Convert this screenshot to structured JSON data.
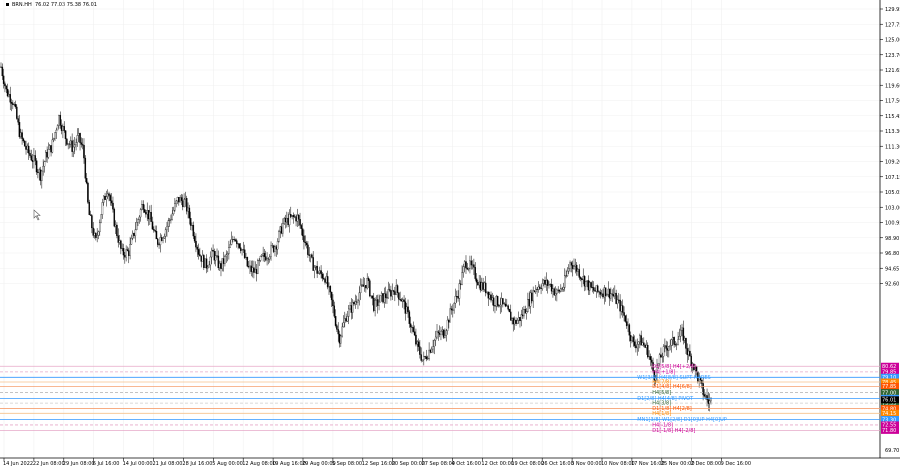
{
  "symbol_header": {
    "symbol": "BRN.HH",
    "ohlc": "76.02 77.03 75.38 76.01"
  },
  "chart_data": {
    "type": "candlestick",
    "symbol": "BRN.HH",
    "price_axis": {
      "min": 68.0,
      "max": 131.0,
      "tick_labels": [
        "129.95",
        "127.75",
        "125.00",
        "123.70",
        "121.65",
        "119.60",
        "117.50",
        "115.45",
        "113.30",
        "111.30",
        "109.20",
        "107.15",
        "105.05",
        "103.00",
        "100.95",
        "98.90",
        "96.80",
        "94.65",
        "92.60"
      ]
    },
    "time_axis": {
      "tick_labels": [
        "14 Jun 2022",
        "22 Jun 08:00",
        "29 Jun 08:00",
        "6 Jul 16:00",
        "14 Jul 00:00",
        "21 Jul 08:00",
        "28 Jul 16:00",
        "5 Aug 00:00",
        "12 Aug 08:00",
        "19 Aug 16:00",
        "29 Aug 00:00",
        "5 Sep 08:00",
        "12 Sep 16:00",
        "20 Sep 00:00",
        "27 Sep 08:00",
        "4 Oct 16:00",
        "12 Oct 00:00",
        "19 Oct 08:00",
        "26 Oct 16:00",
        "3 Nov 00:00",
        "10 Nov 08:00",
        "17 Nov 16:00",
        "25 Nov 00:00",
        "2 Dec 08:00",
        "9 Dec 16:00"
      ]
    },
    "price_path": [
      {
        "x": 0,
        "y": 121.8
      },
      {
        "x": 0.006,
        "y": 118.5
      },
      {
        "x": 0.014,
        "y": 117.0
      },
      {
        "x": 0.022,
        "y": 112.3
      },
      {
        "x": 0.03,
        "y": 110.2
      },
      {
        "x": 0.038,
        "y": 108.8
      },
      {
        "x": 0.045,
        "y": 106.9
      },
      {
        "x": 0.052,
        "y": 109.8
      },
      {
        "x": 0.058,
        "y": 110.9
      },
      {
        "x": 0.066,
        "y": 115.0
      },
      {
        "x": 0.074,
        "y": 112.0
      },
      {
        "x": 0.082,
        "y": 110.6
      },
      {
        "x": 0.088,
        "y": 112.1
      },
      {
        "x": 0.094,
        "y": 110.4
      },
      {
        "x": 0.1,
        "y": 101.8
      },
      {
        "x": 0.108,
        "y": 97.6
      },
      {
        "x": 0.116,
        "y": 102.9
      },
      {
        "x": 0.122,
        "y": 105.2
      },
      {
        "x": 0.13,
        "y": 100.1
      },
      {
        "x": 0.138,
        "y": 96.1
      },
      {
        "x": 0.146,
        "y": 96.4
      },
      {
        "x": 0.154,
        "y": 99.9
      },
      {
        "x": 0.162,
        "y": 103.1
      },
      {
        "x": 0.17,
        "y": 101.0
      },
      {
        "x": 0.178,
        "y": 97.6
      },
      {
        "x": 0.186,
        "y": 99.0
      },
      {
        "x": 0.194,
        "y": 101.2
      },
      {
        "x": 0.202,
        "y": 103.6
      },
      {
        "x": 0.21,
        "y": 103.2
      },
      {
        "x": 0.218,
        "y": 99.9
      },
      {
        "x": 0.226,
        "y": 96.2
      },
      {
        "x": 0.234,
        "y": 94.4
      },
      {
        "x": 0.242,
        "y": 96.2
      },
      {
        "x": 0.25,
        "y": 94.2
      },
      {
        "x": 0.258,
        "y": 95.8
      },
      {
        "x": 0.266,
        "y": 98.6
      },
      {
        "x": 0.274,
        "y": 97.1
      },
      {
        "x": 0.282,
        "y": 94.1
      },
      {
        "x": 0.29,
        "y": 93.6
      },
      {
        "x": 0.298,
        "y": 95.5
      },
      {
        "x": 0.306,
        "y": 96.2
      },
      {
        "x": 0.314,
        "y": 97.4
      },
      {
        "x": 0.322,
        "y": 100.2
      },
      {
        "x": 0.33,
        "y": 100.9
      },
      {
        "x": 0.338,
        "y": 101.2
      },
      {
        "x": 0.346,
        "y": 98.3
      },
      {
        "x": 0.354,
        "y": 95.0
      },
      {
        "x": 0.362,
        "y": 93.5
      },
      {
        "x": 0.37,
        "y": 92.9
      },
      {
        "x": 0.378,
        "y": 89.2
      },
      {
        "x": 0.386,
        "y": 84.4
      },
      {
        "x": 0.394,
        "y": 87.6
      },
      {
        "x": 0.402,
        "y": 89.0
      },
      {
        "x": 0.41,
        "y": 91.0
      },
      {
        "x": 0.418,
        "y": 92.3
      },
      {
        "x": 0.426,
        "y": 88.8
      },
      {
        "x": 0.434,
        "y": 89.9
      },
      {
        "x": 0.442,
        "y": 90.5
      },
      {
        "x": 0.45,
        "y": 91.3
      },
      {
        "x": 0.458,
        "y": 89.7
      },
      {
        "x": 0.466,
        "y": 87.1
      },
      {
        "x": 0.474,
        "y": 83.7
      },
      {
        "x": 0.482,
        "y": 81.3
      },
      {
        "x": 0.49,
        "y": 83.1
      },
      {
        "x": 0.498,
        "y": 84.9
      },
      {
        "x": 0.506,
        "y": 85.3
      },
      {
        "x": 0.514,
        "y": 88.3
      },
      {
        "x": 0.522,
        "y": 90.8
      },
      {
        "x": 0.53,
        "y": 95.0
      },
      {
        "x": 0.538,
        "y": 94.0
      },
      {
        "x": 0.546,
        "y": 92.0
      },
      {
        "x": 0.554,
        "y": 91.2
      },
      {
        "x": 0.562,
        "y": 89.6
      },
      {
        "x": 0.57,
        "y": 89.4
      },
      {
        "x": 0.578,
        "y": 88.1
      },
      {
        "x": 0.586,
        "y": 86.6
      },
      {
        "x": 0.594,
        "y": 87.4
      },
      {
        "x": 0.602,
        "y": 89.4
      },
      {
        "x": 0.61,
        "y": 91.4
      },
      {
        "x": 0.618,
        "y": 92.0
      },
      {
        "x": 0.626,
        "y": 91.9
      },
      {
        "x": 0.634,
        "y": 90.6
      },
      {
        "x": 0.642,
        "y": 91.6
      },
      {
        "x": 0.65,
        "y": 95.0
      },
      {
        "x": 0.658,
        "y": 93.9
      },
      {
        "x": 0.666,
        "y": 92.4
      },
      {
        "x": 0.674,
        "y": 91.2
      },
      {
        "x": 0.682,
        "y": 90.8
      },
      {
        "x": 0.69,
        "y": 91.0
      },
      {
        "x": 0.698,
        "y": 90.5
      },
      {
        "x": 0.706,
        "y": 89.0
      },
      {
        "x": 0.714,
        "y": 86.8
      },
      {
        "x": 0.722,
        "y": 83.5
      },
      {
        "x": 0.73,
        "y": 84.2
      },
      {
        "x": 0.738,
        "y": 82.8
      },
      {
        "x": 0.746,
        "y": 79.3
      },
      {
        "x": 0.754,
        "y": 82.2
      },
      {
        "x": 0.762,
        "y": 83.6
      },
      {
        "x": 0.77,
        "y": 84.1
      },
      {
        "x": 0.778,
        "y": 85.2
      },
      {
        "x": 0.784,
        "y": 82.4
      },
      {
        "x": 0.79,
        "y": 81.0
      },
      {
        "x": 0.796,
        "y": 78.9
      },
      {
        "x": 0.802,
        "y": 76.9
      },
      {
        "x": 0.808,
        "y": 75.6
      },
      {
        "x": 0.812,
        "y": 76.0
      }
    ],
    "levels": [
      {
        "label": "D1[5/8] H4[+2/8]",
        "price": 80.62,
        "line_color": "#e6a8c8",
        "text_color": "#cc0099",
        "tag_bg": "#cc0099",
        "tag": "80.62",
        "style": "solid"
      },
      {
        "label": "H4[+1/8]",
        "price": 79.85,
        "line_color": "#e6a8c8",
        "text_color": "#cc0099",
        "tag_bg": "#cc0099",
        "tag": "79.85",
        "style": "dashed"
      },
      {
        "label": "W1[3/8] H4[8/8] SUPT H4RES",
        "price": 79.1,
        "line_color": "#3399ff",
        "text_color": "#3399ff",
        "tag_bg": "#3399ff",
        "tag": "79.10",
        "style": "solid"
      },
      {
        "label": "H4[7/8]",
        "price": 78.45,
        "line_color": "#f6c28b",
        "text_color": "#ff8800",
        "tag_bg": "#ff8800",
        "tag": "78.45",
        "style": "solid"
      },
      {
        "label": "D1[4/8] H4[6/8]",
        "price": 77.85,
        "line_color": "#f6a070",
        "text_color": "#ff5500",
        "tag_bg": "#ff5500",
        "tag": "77.85",
        "style": "solid"
      },
      {
        "label": "H4[5/8]",
        "price": 77.0,
        "line_color": "#bbbbbb",
        "text_color": "#336633",
        "tag_bg": "#336633",
        "tag": "77.00",
        "style": "dashed"
      },
      {
        "label": "D1[2/8] H4[4/8] PIVOT",
        "price": 76.2,
        "line_color": "#3399ff",
        "text_color": "#3399ff",
        "tag_bg": "#3399ff",
        "tag": "76.20",
        "style": "solid"
      },
      {
        "label": "H4[3/8]",
        "price": 75.55,
        "line_color": "#cccccc",
        "text_color": "#336633",
        "tag_bg": "#336633",
        "tag": "75.55",
        "style": "dashed"
      },
      {
        "label": "D1[1/8] H4[2/8]",
        "price": 74.8,
        "line_color": "#f6a070",
        "text_color": "#ff5500",
        "tag_bg": "#ff5500",
        "tag": "74.80",
        "style": "solid"
      },
      {
        "label": "H4[1/8]",
        "price": 74.15,
        "line_color": "#f6c28b",
        "text_color": "#ff8800",
        "tag_bg": "#ff8800",
        "tag": "74.15",
        "style": "solid"
      },
      {
        "label": "MN1[3/8] W1[2/8] D1[0]UP H4[0]UP",
        "price": 73.3,
        "line_color": "#3399ff",
        "text_color": "#3399ff",
        "tag_bg": "#3399ff",
        "tag": "73.30",
        "style": "solid"
      },
      {
        "label": "H4[-1/8]",
        "price": 72.55,
        "line_color": "#e6a8c8",
        "text_color": "#cc0099",
        "tag_bg": "#cc0099",
        "tag": "72.55",
        "style": "dashed"
      },
      {
        "label": "D1[-1/8] H4[-2/8]",
        "price": 71.8,
        "line_color": "#e6a8c8",
        "text_color": "#cc0099",
        "tag_bg": "#cc0099",
        "tag": "71.80",
        "style": "solid"
      }
    ],
    "current_price": {
      "value": 76.01,
      "tag": "76.01",
      "tag_bg": "#000000"
    },
    "bottom_price_label": "69.70"
  }
}
